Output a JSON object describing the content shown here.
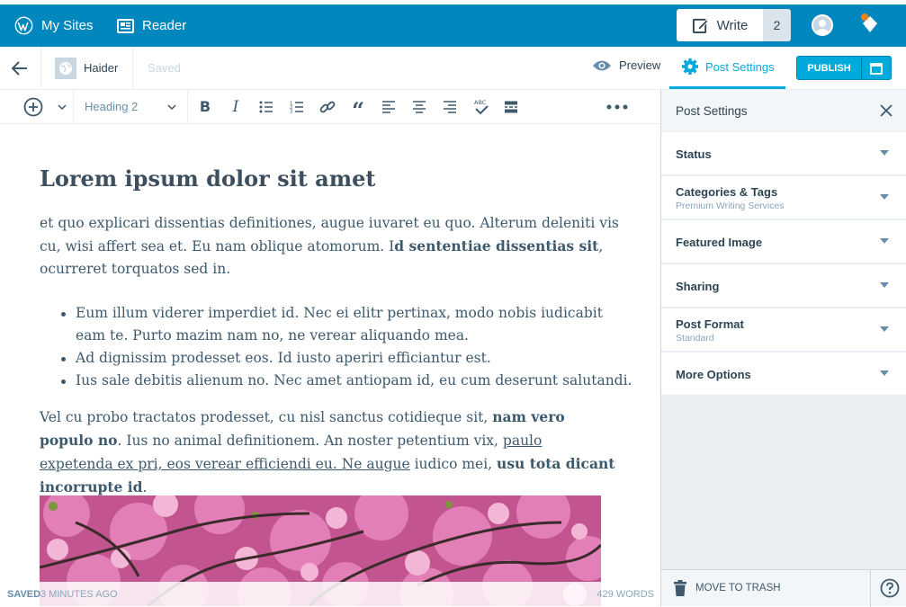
{
  "masterbar": {
    "my_sites": "My Sites",
    "reader": "Reader",
    "write": "Write",
    "write_count": "2"
  },
  "editor_header": {
    "site_name": "Haider",
    "saved": "Saved",
    "preview": "Preview",
    "post_settings": "Post Settings",
    "publish": "PUBLISH"
  },
  "toolbar": {
    "format": "Heading 2"
  },
  "post": {
    "title": "Lorem ipsum dolor sit amet",
    "p1_a": "et quo explicari dissentias definitiones, augue iuvaret eu quo. Alterum deleniti vis cu, wisi affert sea et. Eu nam oblique atomorum. I",
    "p1_bold": "d sententiae dissentias sit",
    "p1_b": ", ocurreret torquatos sed in.",
    "list": [
      "Eum illum viderer imperdiet id. Nec ei elitr pertinax, modo nobis iudicabit eam te. Purto mazim nam no, ne verear aliquando mea.",
      "Ad dignissim prodesset eos. Id iusto aperiri efficiantur est.",
      "Ius sale debitis alienum no. Nec amet antiopam id, eu cum deserunt salutandi."
    ],
    "p2_a": "Vel cu probo tractatos prodesset, cu nisl sanctus cotidieque sit, ",
    "p2_bold1": "nam vero populo no",
    "p2_b": ". Ius no animal definitionem. An noster petentium vix, ",
    "p2_link": "paulo expetenda ex pri, eos verear efficiendi eu. Ne augue",
    "p2_c": " iudico mei, ",
    "p2_bold2": "usu tota dicant incorrupte id",
    "p2_d": "."
  },
  "status": {
    "saved_label": "SAVED",
    "saved_time": "3 MINUTES AGO",
    "word_count": "429 WORDS"
  },
  "sidebar": {
    "title": "Post Settings",
    "sections": [
      {
        "title": "Status",
        "subtitle": ""
      },
      {
        "title": "Categories & Tags",
        "subtitle": "Premium Writing Services"
      },
      {
        "title": "Featured Image",
        "subtitle": ""
      },
      {
        "title": "Sharing",
        "subtitle": ""
      },
      {
        "title": "Post Format",
        "subtitle": "Standard"
      },
      {
        "title": "More Options",
        "subtitle": ""
      }
    ],
    "trash": "MOVE TO TRASH"
  },
  "colors": {
    "masterbar": "#0087be",
    "accent": "#00aadc",
    "sidebar_bg": "#e9eff3"
  }
}
